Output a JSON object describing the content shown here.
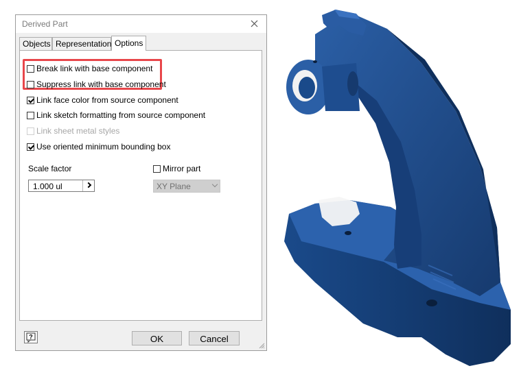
{
  "dialog": {
    "title": "Derived Part",
    "close_icon": "close-icon",
    "tabs": [
      {
        "label": "Objects"
      },
      {
        "label": "Representation"
      },
      {
        "label": "Options",
        "active": true
      }
    ],
    "options": [
      {
        "label": "Break link with base component",
        "checked": false,
        "disabled": false
      },
      {
        "label": "Suppress link with base component",
        "checked": false,
        "disabled": false
      },
      {
        "label": "Link face color from source component",
        "checked": true,
        "disabled": false
      },
      {
        "label": "Link sketch formatting from source component",
        "checked": false,
        "disabled": false
      },
      {
        "label": "Link sheet metal styles",
        "checked": false,
        "disabled": true
      },
      {
        "label": "Use oriented minimum bounding box",
        "checked": true,
        "disabled": false
      }
    ],
    "scale": {
      "label": "Scale factor",
      "value": "1.000 ul"
    },
    "mirror": {
      "label": "Mirror part",
      "checked": false,
      "plane": "XY Plane"
    },
    "buttons": {
      "ok": "OK",
      "cancel": "Cancel"
    },
    "help_icon": "help-icon"
  },
  "colors": {
    "part_blue": "#1f4f8f",
    "highlight": "#e8464a"
  }
}
